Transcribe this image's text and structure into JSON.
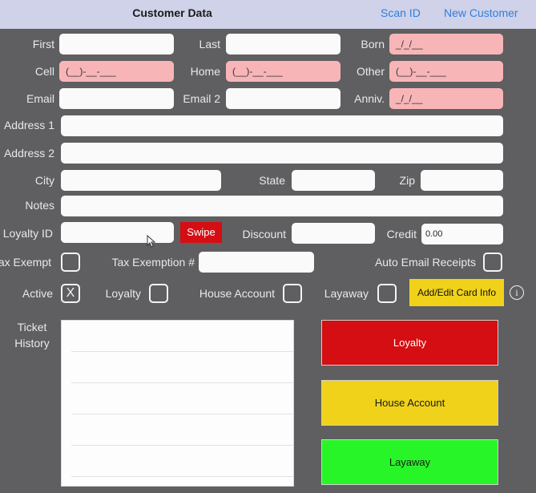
{
  "header": {
    "title": "Customer Data",
    "scan_id": "Scan ID",
    "new_customer": "New Customer"
  },
  "labels": {
    "first": "First",
    "last": "Last",
    "born": "Born",
    "cell": "Cell",
    "home": "Home",
    "other": "Other",
    "email": "Email",
    "email2": "Email 2",
    "anniv": "Anniv.",
    "address1": "Address 1",
    "address2": "Address 2",
    "city": "City",
    "state": "State",
    "zip": "Zip",
    "notes": "Notes",
    "loyalty_id": "Loyalty ID",
    "discount": "Discount",
    "credit": "Credit",
    "tax_exempt": "Tax Exempt",
    "tax_exemption_num": "Tax Exemption #",
    "auto_email_receipts": "Auto Email Receipts",
    "active": "Active",
    "loyalty": "Loyalty",
    "house_account": "House Account",
    "layaway": "Layaway",
    "ticket_history": "Ticket History"
  },
  "placeholders": {
    "born": "_/_/__",
    "anniv": "_/_/__",
    "cell": "(__)-__-___",
    "home": "(__)-__-___",
    "other": "(__)-__-___"
  },
  "values": {
    "credit": "0.00"
  },
  "checkboxes": {
    "active": "X"
  },
  "buttons": {
    "swipe": "Swipe",
    "add_edit_card": "Add/Edit Card Info",
    "info": "i"
  },
  "tiles": {
    "loyalty": "Loyalty",
    "house_account": "House Account",
    "layaway": "Layaway"
  },
  "colors": {
    "loyalty": "#d40e12",
    "house_account": "#f0d21a",
    "layaway": "#28f528",
    "swipe": "#d40e12",
    "pink": "#f7b5b7"
  }
}
